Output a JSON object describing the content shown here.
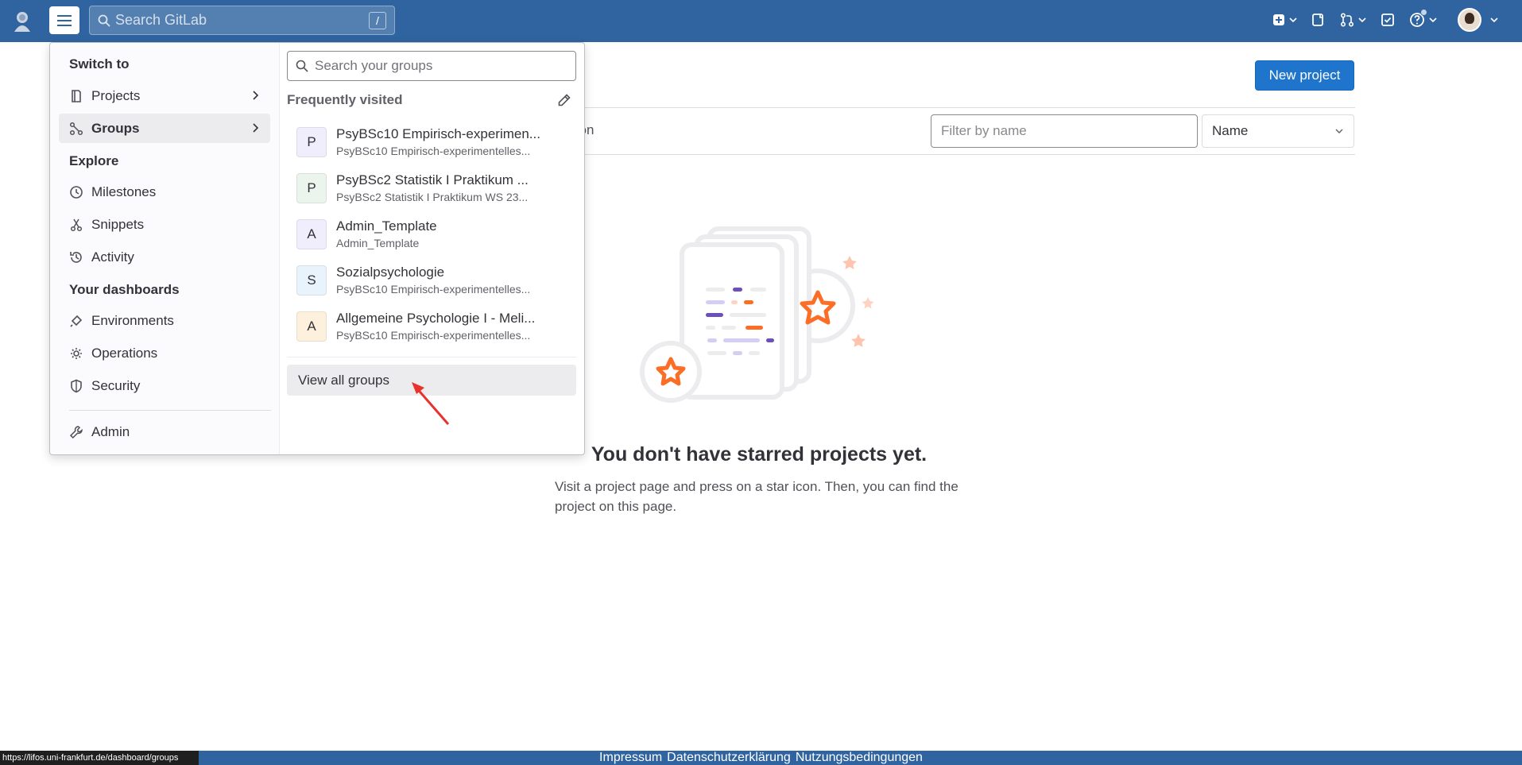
{
  "topbar": {
    "search_placeholder": "Search GitLab",
    "search_shortcut": "/",
    "icons": [
      "logo-icon",
      "hamburger-icon",
      "create-new-icon",
      "issues-icon",
      "merge-requests-icon",
      "todos-icon",
      "help-icon",
      "avatar"
    ]
  },
  "menu": {
    "switch_to": "Switch to",
    "projects": "Projects",
    "groups": "Groups",
    "explore": "Explore",
    "milestones": "Milestones",
    "snippets": "Snippets",
    "activity": "Activity",
    "your_dashboards": "Your dashboards",
    "environments": "Environments",
    "operations": "Operations",
    "security": "Security",
    "admin": "Admin"
  },
  "groups_panel": {
    "search_placeholder": "Search your groups",
    "frequently_visited": "Frequently visited",
    "items": [
      {
        "letter": "P",
        "name": "PsyBSc10 Empirisch-experimen...",
        "sub": "PsyBSc10 Empirisch-experimentelles...",
        "color": "#f0eefc"
      },
      {
        "letter": "P",
        "name": "PsyBSc2 Statistik I Praktikum ...",
        "sub": "PsyBSc2 Statistik I Praktikum WS 23...",
        "color": "#ecf4ee"
      },
      {
        "letter": "A",
        "name": "Admin_Template",
        "sub": "Admin_Template",
        "color": "#f0eefc"
      },
      {
        "letter": "S",
        "name": "Sozialpsychologie",
        "sub": "PsyBSc10 Empirisch-experimentelles...",
        "color": "#e9f3fc"
      },
      {
        "letter": "A",
        "name": "Allgemeine Psychologie I - Meli...",
        "sub": "PsyBSc10 Empirisch-experimentelles...",
        "color": "#fdf1dd"
      }
    ],
    "view_all": "View all groups"
  },
  "main": {
    "new_project": "New project",
    "tab_fragment": "tion",
    "filter_placeholder": "Filter by name",
    "sort_selected": "Name",
    "empty_title": "You don't have starred projects yet.",
    "empty_desc": "Visit a project page and press on a star icon. Then, you can find the project on this page."
  },
  "footer": {
    "impressum": "Impressum",
    "datenschutz": "Datenschutzerklärung",
    "nutzung": "Nutzungsbedingungen"
  },
  "status_url": "https://lifos.uni-frankfurt.de/dashboard/groups",
  "colors": {
    "topbar": "#2f64a0",
    "primary_button": "#1f75cb",
    "annotation_arrow": "#e8322b"
  }
}
